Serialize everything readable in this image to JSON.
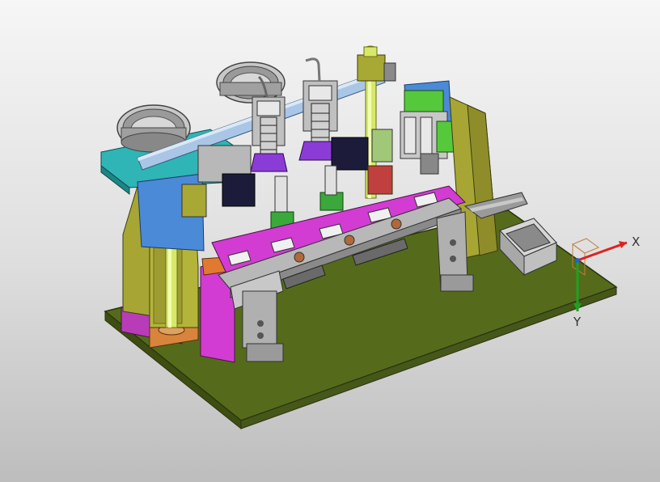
{
  "viewport": {
    "colors": {
      "background_top": "#f6f6f6",
      "background_bottom": "#bdbdbd",
      "base_plate": "#556b1b",
      "frame_olive": "#a7a634",
      "teal_plate": "#2fb5b5",
      "magenta_rail": "#d23cd2",
      "steel": "#b8b8b8",
      "blue_cover": "#4b8ad6",
      "green_block": "#56c83c",
      "yellow_post": "#d7e86a",
      "axis_x": "#e02020",
      "axis_y": "#20a020"
    },
    "triad": {
      "x_label": "X",
      "y_label": "Y"
    }
  }
}
